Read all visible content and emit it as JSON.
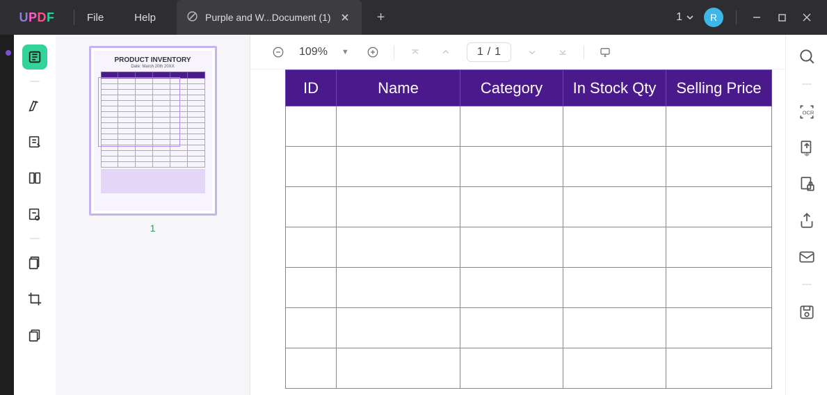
{
  "app": {
    "logo": "UPDF"
  },
  "menu": {
    "file": "File",
    "help": "Help"
  },
  "tab": {
    "title": "Purple and W...Document (1)"
  },
  "titlebar": {
    "open_count": "1",
    "avatar_initial": "R"
  },
  "toolbar": {
    "zoom": "109%",
    "page_current": "1",
    "page_sep": "/",
    "page_total": "1"
  },
  "thumbnail": {
    "title": "PRODUCT INVENTORY",
    "date": "Date: March 20th 20XX",
    "page_number": "1"
  },
  "document": {
    "columns": [
      "ID",
      "Name",
      "Category",
      "In Stock Qty",
      "Selling Price"
    ],
    "visible_blank_rows": 7
  }
}
